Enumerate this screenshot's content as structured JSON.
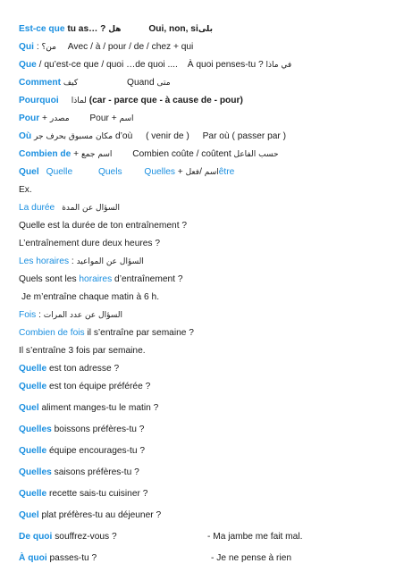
{
  "lines": {
    "l1": {
      "q": "Est-ce que",
      "rest": " tu as… ? ",
      "ar": "هل",
      "ans": "Oui, non, si",
      "ans_ar": "بلى"
    },
    "l2": {
      "q": "Qui",
      "sep": " : ",
      "ar": "من؟",
      "rest": "Avec / à / pour / de / chez + qui"
    },
    "l3": {
      "q": "Que",
      "rest": " / qu’est-ce que / quoi …de quoi ....",
      "rest2": "À quoi penses-tu ? ",
      "ar": "في ماذا"
    },
    "l4": {
      "q": "Comment",
      "ar": " كيف",
      "q2": "Quand",
      "ar2": " متى"
    },
    "l5": {
      "q": "Pourquoi",
      "ar": "لماذا",
      "rest": " (car - parce que - à cause de - pour)"
    },
    "l6": {
      "q": "Pour",
      "rest": " + ",
      "ar": "مصدر",
      "rest2": "Pour + ",
      "ar2": "اسم"
    },
    "l7": {
      "q": "Où",
      "ar": " مكان مسبوق بحرف جر ",
      "rest": "d’où",
      "rest2": "( venir de )",
      "rest3": "Par où ( passer par )"
    },
    "l8": {
      "q": "Combien de",
      "rest": " + ",
      "ar": "اسم جمع",
      "rest2": "Combien coûte / coûtent ",
      "ar2": "حسب الفاعل"
    },
    "l9": {
      "q": "Quel",
      "q2": "Quelle",
      "q3": "Quels",
      "q4": "Quelles",
      "rest": " + ",
      "ar": "اسم",
      "rest2": " /",
      "ar2": "فعل",
      "q5": "être"
    },
    "l10": {
      "text": "Ex."
    },
    "l11": {
      "q": "La durée",
      "ar": "السؤال عن المدة"
    },
    "l12": {
      "text": "Quelle est la durée de ton entraînement ?"
    },
    "l13": {
      "text": "L’entraînement dure deux heures ?"
    },
    "l14": {
      "q": "Les horaires",
      "sep": " : ",
      "ar": "السؤال عن المواعيد"
    },
    "l15": {
      "a": "Quels sont les ",
      "q": "horaires",
      "b": " d’entraînement ?"
    },
    "l16": {
      "text": "Je m’entraîne chaque matin à 6 h."
    },
    "l17": {
      "q": "Fois",
      "sep": " : ",
      "ar": "السؤال عن عدد المرات"
    },
    "l18": {
      "q": "Combien de fois",
      "rest": " il s’entraîne par semaine ?"
    },
    "l19": {
      "text": "Il s’entraîne 3 fois par semaine."
    },
    "l20": {
      "q": "Quelle",
      "rest": " est ton adresse ?"
    },
    "l21": {
      "q": "Quelle",
      "rest": " est ton équipe préférée ?"
    },
    "l22": {
      "q": "Quel",
      "rest": " aliment manges-tu le matin ?"
    },
    "l23": {
      "q": "Quelles",
      "rest": " boissons préfères-tu ?"
    },
    "l24": {
      "q": "Quelle",
      "rest": " équipe encourages-tu ?"
    },
    "l25": {
      "q": "Quelles",
      "rest": " saisons préfères-tu ?"
    },
    "l26": {
      "q": "Quelle",
      "rest": " recette sais-tu cuisiner ?"
    },
    "l27": {
      "q": "Quel",
      "rest": " plat préfères-tu au déjeuner ?"
    },
    "l28": {
      "q": "De quoi",
      "rest": " souffrez-vous ?",
      "ans": "- Ma jambe me fait mal."
    },
    "l29": {
      "q": "À quoi",
      "rest": " passes-tu ?",
      "ans": "- Je ne pense à rien"
    }
  }
}
